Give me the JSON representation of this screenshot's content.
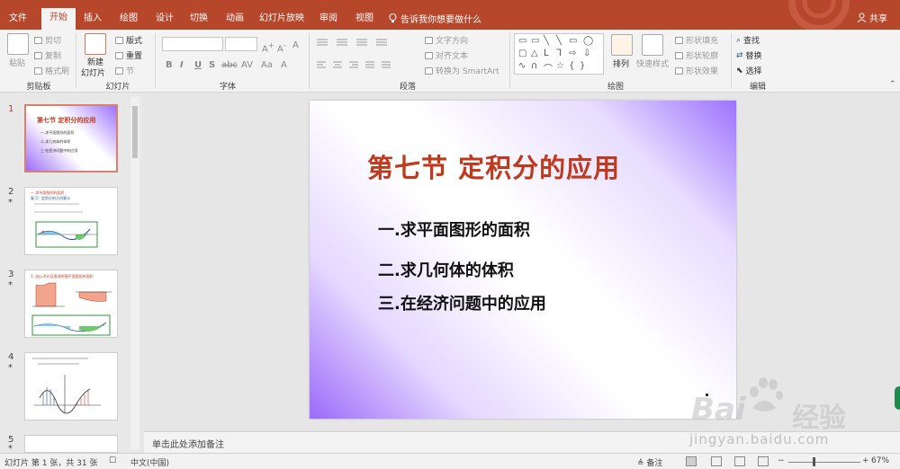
{
  "tabs": [
    {
      "label": "文件",
      "active": false
    },
    {
      "label": "开始",
      "active": true
    },
    {
      "label": "插入",
      "active": false
    },
    {
      "label": "绘图",
      "active": false
    },
    {
      "label": "设计",
      "active": false
    },
    {
      "label": "切换",
      "active": false
    },
    {
      "label": "动画",
      "active": false
    },
    {
      "label": "幻灯片放映",
      "active": false
    },
    {
      "label": "审阅",
      "active": false
    },
    {
      "label": "视图",
      "active": false
    }
  ],
  "tell_me": "告诉我你想要做什么",
  "share": "共享",
  "ribbon": {
    "clipboard": {
      "paste": "粘贴",
      "cut": "剪切",
      "copy": "复制",
      "format_painter": "格式刷",
      "label": "剪贴板"
    },
    "slides": {
      "new_slide": "新建",
      "new_slide2": "幻灯片",
      "layout": "版式",
      "reset": "重置",
      "section": "节",
      "label": "幻灯片"
    },
    "font": {
      "label": "字体",
      "buttons": [
        "B",
        "I",
        "U",
        "S",
        "abc",
        "AV",
        "Aa",
        "A"
      ]
    },
    "paragraph": {
      "text_direction": "文字方向",
      "align_text": "对齐文本",
      "smartart": "转换为 SmartArt",
      "label": "段落"
    },
    "drawing": {
      "arrange": "排列",
      "quick_styles": "快速样式",
      "shape_fill": "形状填充",
      "shape_outline": "形状轮廓",
      "shape_effects": "形状效果",
      "label": "绘图"
    },
    "editing": {
      "find": "查找",
      "replace": "替换",
      "select": "选择",
      "label": "编辑"
    }
  },
  "thumbnails": [
    {
      "num": "1",
      "star": "",
      "selected": true,
      "title": "第七节  定积分的应用",
      "lines": [
        "一.求平面图形的面积",
        "二.求几何体的体积",
        "三.在经济问题中的应用"
      ]
    },
    {
      "num": "2",
      "star": "*",
      "selected": false,
      "title": "一.求平面图形的面积",
      "lines": [
        "复习：定积分的几何意义"
      ]
    },
    {
      "num": "3",
      "star": "*",
      "selected": false,
      "title": "1. 由y=f(x)及直线所围平面图形的面积",
      "lines": []
    },
    {
      "num": "4",
      "star": "*",
      "selected": false,
      "title": "",
      "lines": []
    },
    {
      "num": "5",
      "star": "*",
      "selected": false,
      "title": "",
      "lines": []
    }
  ],
  "slide": {
    "title": "第七节    定积分的应用",
    "items": [
      "一.求平面图形的面积",
      "二.求几何体的体积",
      "三.在经济问题中的应用"
    ],
    "title_color": "#c0391c"
  },
  "notes_placeholder": "单击此处添加备注",
  "status": {
    "slide_info": "幻灯片 第 1 张，共 31 张",
    "language": "中文(中国)",
    "notes": "备注",
    "zoom": "67%"
  },
  "watermark": {
    "brand": "Bai",
    "brand_cn": "经验",
    "url": "jingyan.baidu.com"
  },
  "colors": {
    "accent": "#b7472a",
    "slide_gradient": "#9b6af9"
  }
}
